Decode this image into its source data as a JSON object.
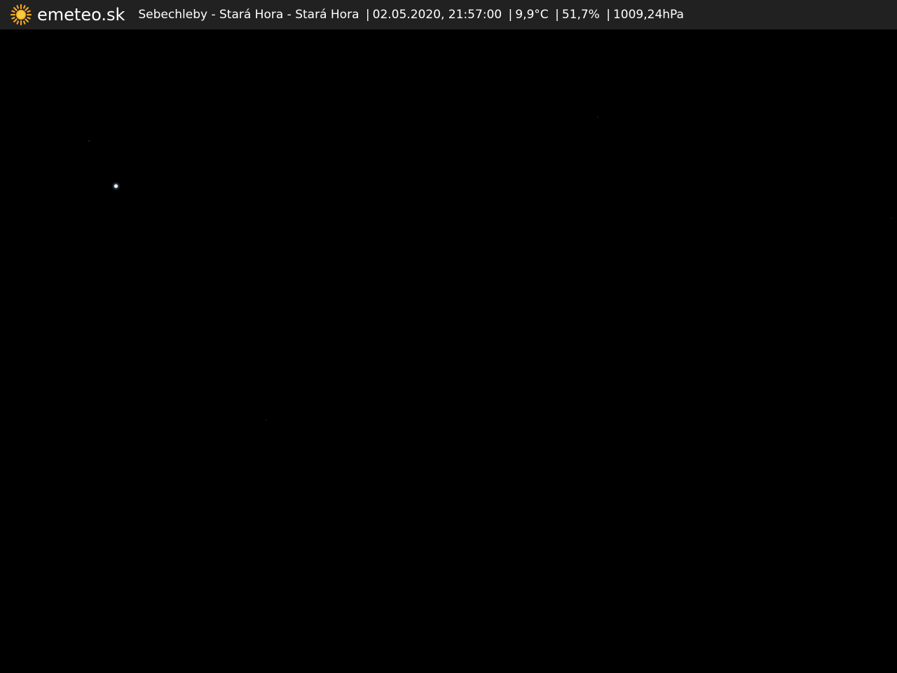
{
  "header": {
    "brand": "emeteo.sk",
    "logo_icon": "sun-icon",
    "logo_color": "#f5a623",
    "location": "Sebechleby - Stará Hora - Stará Hora",
    "datetime": "02.05.2020, 21:57:00",
    "temperature": "9,9°C",
    "humidity": "51,7%",
    "pressure": "1009,24hPa",
    "separator": "|"
  },
  "camera": {
    "background_color": "#000000"
  }
}
